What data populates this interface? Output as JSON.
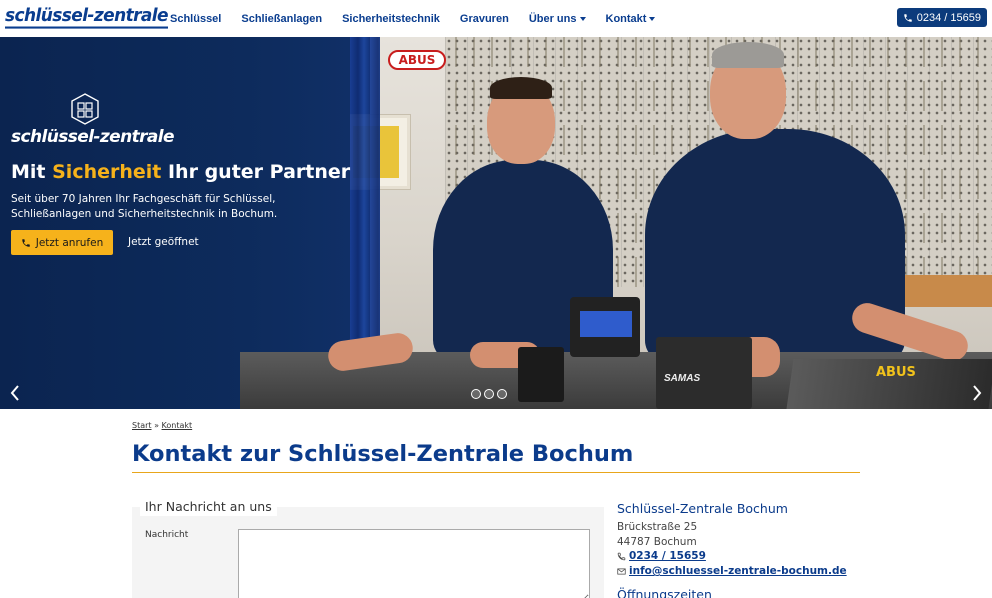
{
  "brand": {
    "logo_text": "schlüssel-zentrale"
  },
  "nav": {
    "items": [
      {
        "label": "Schlüssel",
        "dropdown": false
      },
      {
        "label": "Schließanlagen",
        "dropdown": false
      },
      {
        "label": "Sicherheitstechnik",
        "dropdown": false
      },
      {
        "label": "Gravuren",
        "dropdown": false
      },
      {
        "label": "Über uns",
        "dropdown": true
      },
      {
        "label": "Kontakt",
        "dropdown": true
      }
    ],
    "phone_label": "0234 / 15659"
  },
  "hero": {
    "brand_text": "schlüssel-zentrale",
    "title_pre": "Mit ",
    "title_highlight": "Sicherheit",
    "title_post": " Ihr guter Partner",
    "subtitle": "Seit über 70 Jahren Ihr Fachgeschäft für Schlüssel, Schließanlagen und Sicherheitstechnik in Bochum.",
    "cta_label": "Jetzt anrufen",
    "status_label": "Jetzt geöffnet",
    "abus_sign": "ABUS",
    "register_brand": "SAMAS",
    "poster_text": "ABUS",
    "slide_count": 3,
    "active_slide": 1
  },
  "breadcrumb": {
    "home": "Start",
    "separator": "»",
    "current": "Kontakt"
  },
  "page_title": "Kontakt zur Schlüssel-Zentrale Bochum",
  "form": {
    "legend": "Ihr Nachricht an uns",
    "message_label": "Nachricht",
    "message_value": ""
  },
  "sidebar": {
    "title": "Schlüssel-Zentrale Bochum",
    "street": "Brückstraße 25",
    "city": "44787 Bochum",
    "phone": "0234 / 15659",
    "email": "info@schluessel-zentrale-bochum.de",
    "hours_title": "Öffnungszeiten"
  },
  "colors": {
    "brand_blue": "#0b3b8b",
    "accent_yellow": "#f6b21b",
    "hero_navy": "#0d2b5c"
  }
}
